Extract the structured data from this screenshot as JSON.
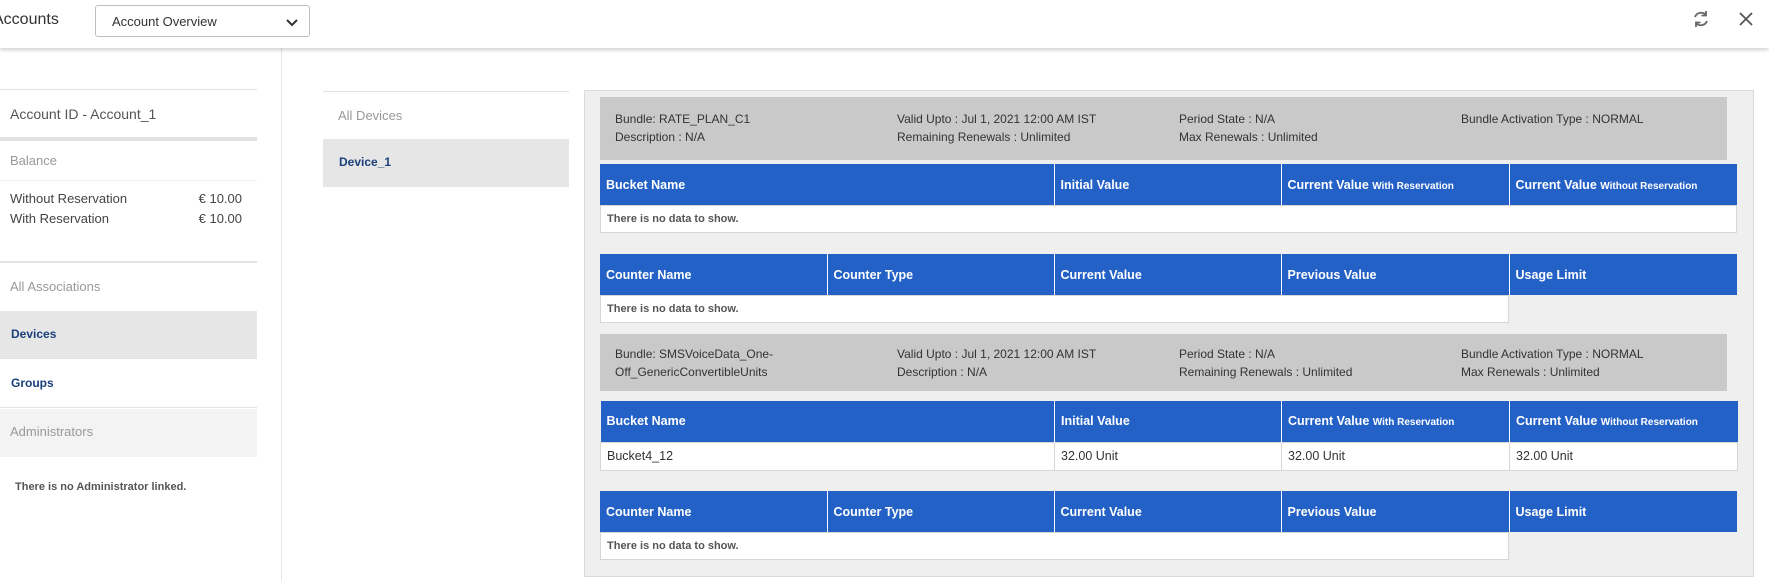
{
  "header": {
    "title": "Accounts",
    "view_select": "Account Overview"
  },
  "sidebar": {
    "account_id": "Account ID - Account_1",
    "balance_header": "Balance",
    "balances": [
      {
        "label": "Without Reservation",
        "value": "€ 10.00"
      },
      {
        "label": "With Reservation",
        "value": "€ 10.00"
      }
    ],
    "associations_header": "All Associations",
    "items": [
      {
        "label": "Devices"
      },
      {
        "label": "Groups"
      }
    ],
    "administrators_header": "Administrators",
    "no_admin_text": "There is no Administrator linked."
  },
  "devices": {
    "header": "All Devices",
    "items": [
      {
        "label": "Device_1"
      }
    ]
  },
  "bundles": [
    {
      "bundle": "Bundle: RATE_PLAN_C1",
      "description": "Description : N/A",
      "valid_upto": "Valid Upto : Jul 1, 2021 12:00 AM IST",
      "remaining_renewals": "Remaining Renewals : Unlimited",
      "period_state": "Period State : N/A",
      "max_renewals": "Max Renewals : Unlimited",
      "activation_type": "Bundle Activation Type : NORMAL",
      "buckets_empty": "There is no data to show.",
      "counters_empty": "There is no data to show."
    },
    {
      "bundle": "Bundle: SMSVoiceData_One-Off_GenericConvertibleUnits",
      "bundle_line1": "Bundle: SMSVoiceData_One-",
      "bundle_line2": "Off_GenericConvertibleUnits",
      "valid_upto": "Valid Upto : Jul 1, 2021 12:00 AM IST",
      "description": "Description : N/A",
      "period_state": "Period State : N/A",
      "remaining_renewals": "Remaining Renewals : Unlimited",
      "activation_type": "Bundle Activation Type : NORMAL",
      "max_renewals": "Max Renewals : Unlimited",
      "buckets": [
        {
          "name": "Bucket4_12",
          "initial": "32.00 Unit",
          "with_res": "32.00 Unit",
          "without_res": "32.00 Unit"
        }
      ],
      "counters_empty": "There is no data to show."
    }
  ],
  "bucket_columns": {
    "name": "Bucket Name",
    "initial": "Initial Value",
    "current": "Current Value",
    "with_res": "With Reservation",
    "without_res": "Without Reservation"
  },
  "counter_columns": [
    "Counter Name",
    "Counter Type",
    "Current Value",
    "Previous Value",
    "Usage Limit"
  ],
  "colors": {
    "header_blue": "#2361c6",
    "nav_text": "#1a3f7a",
    "bundle_bg": "#c9c9c9"
  }
}
